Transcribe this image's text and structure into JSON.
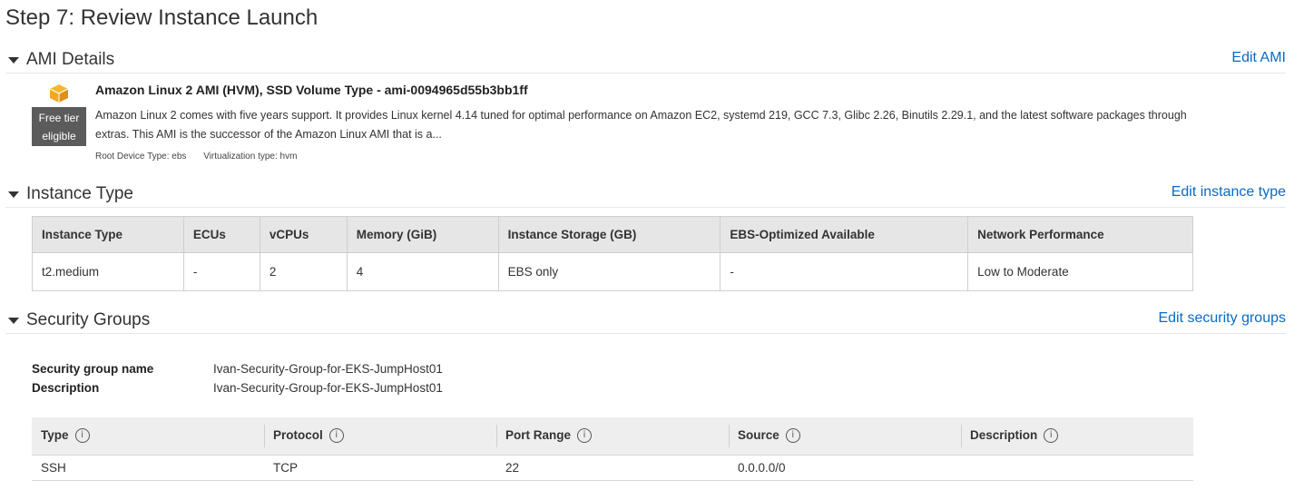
{
  "page_title": "Step 7: Review Instance Launch",
  "ami": {
    "section_title": "AMI Details",
    "edit_label": "Edit AMI",
    "badge_line1": "Free tier",
    "badge_line2": "eligible",
    "name": "Amazon Linux 2 AMI (HVM), SSD Volume Type - ami-0094965d55b3bb1ff",
    "description": "Amazon Linux 2 comes with five years support. It provides Linux kernel 4.14 tuned for optimal performance on Amazon EC2, systemd 219, GCC 7.3, Glibc 2.26, Binutils 2.29.1, and the latest software packages through extras. This AMI is the successor of the Amazon Linux AMI that is a...",
    "root_device": "Root Device Type: ebs",
    "virtualization": "Virtualization type: hvm",
    "icon": "cube-icon",
    "icon_color": "#f5a623"
  },
  "instance_type": {
    "section_title": "Instance Type",
    "edit_label": "Edit instance type",
    "headers": [
      "Instance Type",
      "ECUs",
      "vCPUs",
      "Memory (GiB)",
      "Instance Storage (GB)",
      "EBS-Optimized Available",
      "Network Performance"
    ],
    "row": [
      "t2.medium",
      "-",
      "2",
      "4",
      "EBS only",
      "-",
      "Low to Moderate"
    ]
  },
  "security_groups": {
    "section_title": "Security Groups",
    "edit_label": "Edit security groups",
    "name_label": "Security group name",
    "name_value": "Ivan-Security-Group-for-EKS-JumpHost01",
    "desc_label": "Description",
    "desc_value": "Ivan-Security-Group-for-EKS-JumpHost01",
    "headers": [
      "Type",
      "Protocol",
      "Port Range",
      "Source",
      "Description"
    ],
    "info_glyph": "i",
    "rows": [
      [
        "SSH",
        "TCP",
        "22",
        "0.0.0.0/0",
        ""
      ]
    ]
  },
  "colors": {
    "link": "#0a6ac5",
    "badge_bg": "#5b5b5b",
    "header_bg": "#e6e6e6"
  }
}
